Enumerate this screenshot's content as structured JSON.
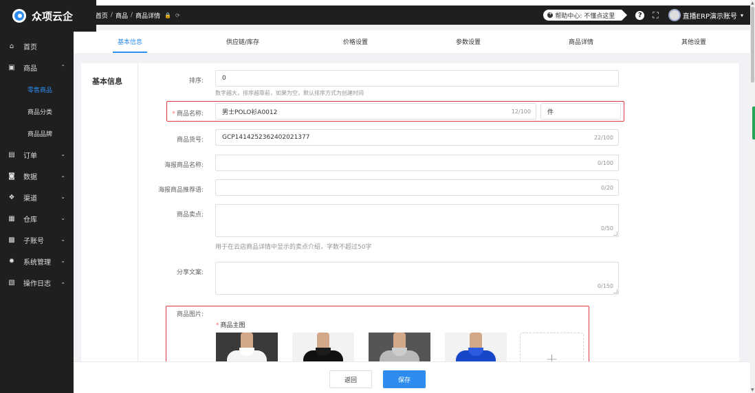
{
  "brand": {
    "name": "众项云企"
  },
  "sidebar": {
    "items": [
      {
        "label": "首页",
        "icon": "home-icon",
        "glyph": "⌂",
        "has_chevron": false
      },
      {
        "label": "商品",
        "icon": "goods-icon",
        "glyph": "▣",
        "has_chevron": true,
        "chevron": "⌃"
      },
      {
        "label": "订单",
        "icon": "order-icon",
        "glyph": "▤",
        "has_chevron": true,
        "chevron": "⌄"
      },
      {
        "label": "数据",
        "icon": "data-icon",
        "glyph": "◙",
        "has_chevron": true,
        "chevron": "⌄"
      },
      {
        "label": "渠道",
        "icon": "channel-icon",
        "glyph": "❖",
        "has_chevron": true,
        "chevron": "⌄"
      },
      {
        "label": "仓库",
        "icon": "warehouse-icon",
        "glyph": "▦",
        "has_chevron": true,
        "chevron": "⌄"
      },
      {
        "label": "子账号",
        "icon": "subaccount-icon",
        "glyph": "▩",
        "has_chevron": true,
        "chevron": "⌄"
      },
      {
        "label": "系统管理",
        "icon": "settings-icon",
        "glyph": "✹",
        "has_chevron": true,
        "chevron": "⌄"
      },
      {
        "label": "操作日志",
        "icon": "log-icon",
        "glyph": "▧",
        "has_chevron": true,
        "chevron": "⌄"
      }
    ],
    "sub_items": [
      {
        "label": "零售商品",
        "active": true
      },
      {
        "label": "商品分类",
        "active": false
      },
      {
        "label": "商品品牌",
        "active": false
      }
    ]
  },
  "header": {
    "menu_icon": "☰",
    "breadcrumb": [
      "首页",
      "商品",
      "商品详情"
    ],
    "separator": "/",
    "lock_icon": "🔒",
    "refresh_icon": "⟳",
    "help_text": "帮助中心: 不懂点这里",
    "question_glyph": "?",
    "fullscreen_glyph": "⛶",
    "account": "直播ERP演示账号",
    "caret": "▾"
  },
  "tabs": [
    {
      "label": "基本信息",
      "active": true
    },
    {
      "label": "供应链/库存",
      "active": false
    },
    {
      "label": "价格设置",
      "active": false
    },
    {
      "label": "参数设置",
      "active": false
    },
    {
      "label": "商品详情",
      "active": false
    },
    {
      "label": "其他设置",
      "active": false
    }
  ],
  "form": {
    "section_title": "基本信息",
    "sort": {
      "label": "排序:",
      "value": "0",
      "hint": "数字越大，排序越靠前，如果为空，默认排序方式为创建时间"
    },
    "name": {
      "required_mark": "*",
      "label": "商品名称:",
      "value": "男士POLO衫A0012",
      "count": "12/100",
      "unit": "件"
    },
    "sku": {
      "label": "商品货号:",
      "value": "GCP1414252362402021377",
      "count": "22/100"
    },
    "poster_name": {
      "label": "海报商品名称:",
      "value": "",
      "count": "0/100"
    },
    "poster_slogan": {
      "label": "海报商品推荐语:",
      "value": "",
      "count": "0/20"
    },
    "selling_point": {
      "label": "商品卖点:",
      "count": "0/50",
      "hint": "用于在云店商品详情中显示的卖点介绍，字数不超过50字"
    },
    "share_text": {
      "label": "分享文案:",
      "count": "0/150"
    },
    "images": {
      "label": "商品图片:",
      "required_mark": "*",
      "main_label": "商品主图",
      "thumbs": [
        {
          "name": "white-polo-image",
          "shirt": "#f4f4f4",
          "collar": "#ffffff",
          "bg": "#3a3a3a"
        },
        {
          "name": "black-polo-image",
          "shirt": "#111111",
          "collar": "#1c1c1c",
          "bg": "#f2f2f2"
        },
        {
          "name": "grey-polo-image",
          "shirt": "#b9b9b9",
          "collar": "#cdcdcd",
          "bg": "#555555"
        },
        {
          "name": "blue-polo-image",
          "shirt": "#1846c8",
          "collar": "#2a5be0",
          "bg": "#f2f2f2"
        }
      ],
      "upload_glyph": "+"
    }
  },
  "footer": {
    "back": "返回",
    "save": "保存"
  },
  "colors": {
    "accent": "#2d8cf0",
    "highlight_border": "#e0383e",
    "sidebar_bg": "#1f1f1f"
  }
}
